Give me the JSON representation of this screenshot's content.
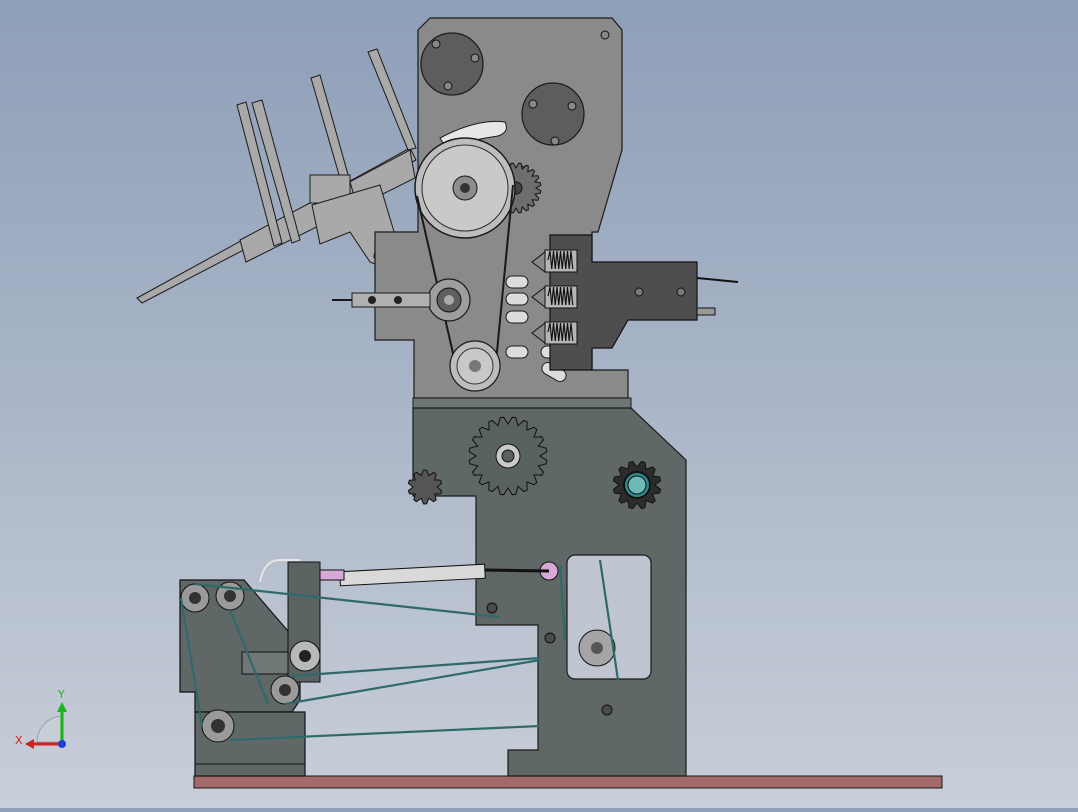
{
  "triad": {
    "x_label": "X",
    "y_label": "Y"
  },
  "colors": {
    "upper_housing": "#8a8a8a",
    "lower_frame": "#5f6767",
    "dark_block": "#545454",
    "edge": "#1a1a1a",
    "belt": "#2f6a6a",
    "base_plate": "#a36a6a",
    "axis_x": "#d21f1f",
    "axis_y": "#18b418",
    "axis_z": "#1f3fd2"
  }
}
